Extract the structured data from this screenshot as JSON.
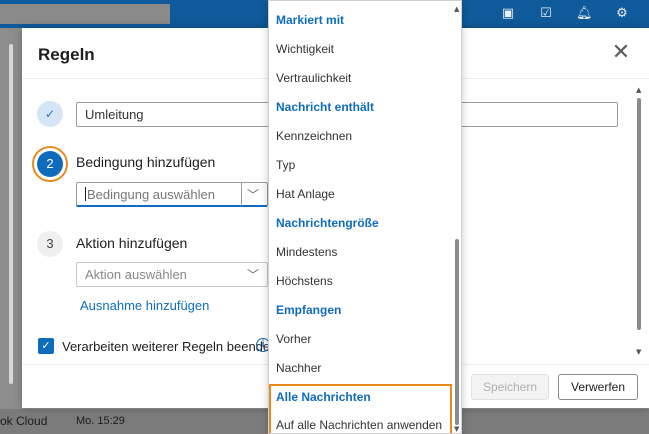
{
  "background": {
    "cloud_label": "ok Cloud",
    "time_label": "Mo. 15:29",
    "top_icons": [
      "teams-icon",
      "checklist-icon",
      "bell-icon",
      "gear-icon"
    ]
  },
  "dialog": {
    "title": "Regeln",
    "rule_name_value": "Umleitung",
    "step_numbers": {
      "two": "2",
      "three": "3"
    },
    "condition_label": "Bedingung hinzufügen",
    "condition_placeholder": "Bedingung auswählen",
    "action_label": "Aktion hinzufügen",
    "action_placeholder": "Aktion auswählen",
    "exception_link": "Ausnahme hinzufügen",
    "stop_processing_label": "Verarbeiten weiterer Regeln beenden",
    "stop_processing_checked": true,
    "save_label": "Speichern",
    "discard_label": "Verwerfen"
  },
  "dropdown": {
    "items": [
      {
        "label": "Markiert mit",
        "type": "header"
      },
      {
        "label": "Wichtigkeit",
        "type": "option"
      },
      {
        "label": "Vertraulichkeit",
        "type": "option"
      },
      {
        "label": "Nachricht enthält",
        "type": "header"
      },
      {
        "label": "Kennzeichnen",
        "type": "option"
      },
      {
        "label": "Typ",
        "type": "option"
      },
      {
        "label": "Hat Anlage",
        "type": "option"
      },
      {
        "label": "Nachrichtengröße",
        "type": "header"
      },
      {
        "label": "Mindestens",
        "type": "option"
      },
      {
        "label": "Höchstens",
        "type": "option"
      },
      {
        "label": "Empfangen",
        "type": "header"
      },
      {
        "label": "Vorher",
        "type": "option"
      },
      {
        "label": "Nachher",
        "type": "option"
      },
      {
        "label": "Alle Nachrichten",
        "type": "header"
      },
      {
        "label": "Auf alle Nachrichten anwenden",
        "type": "option"
      }
    ]
  },
  "colors": {
    "accent": "#0f6cbd",
    "highlight": "#e88a1e",
    "topbar": "#0f5a9a"
  }
}
